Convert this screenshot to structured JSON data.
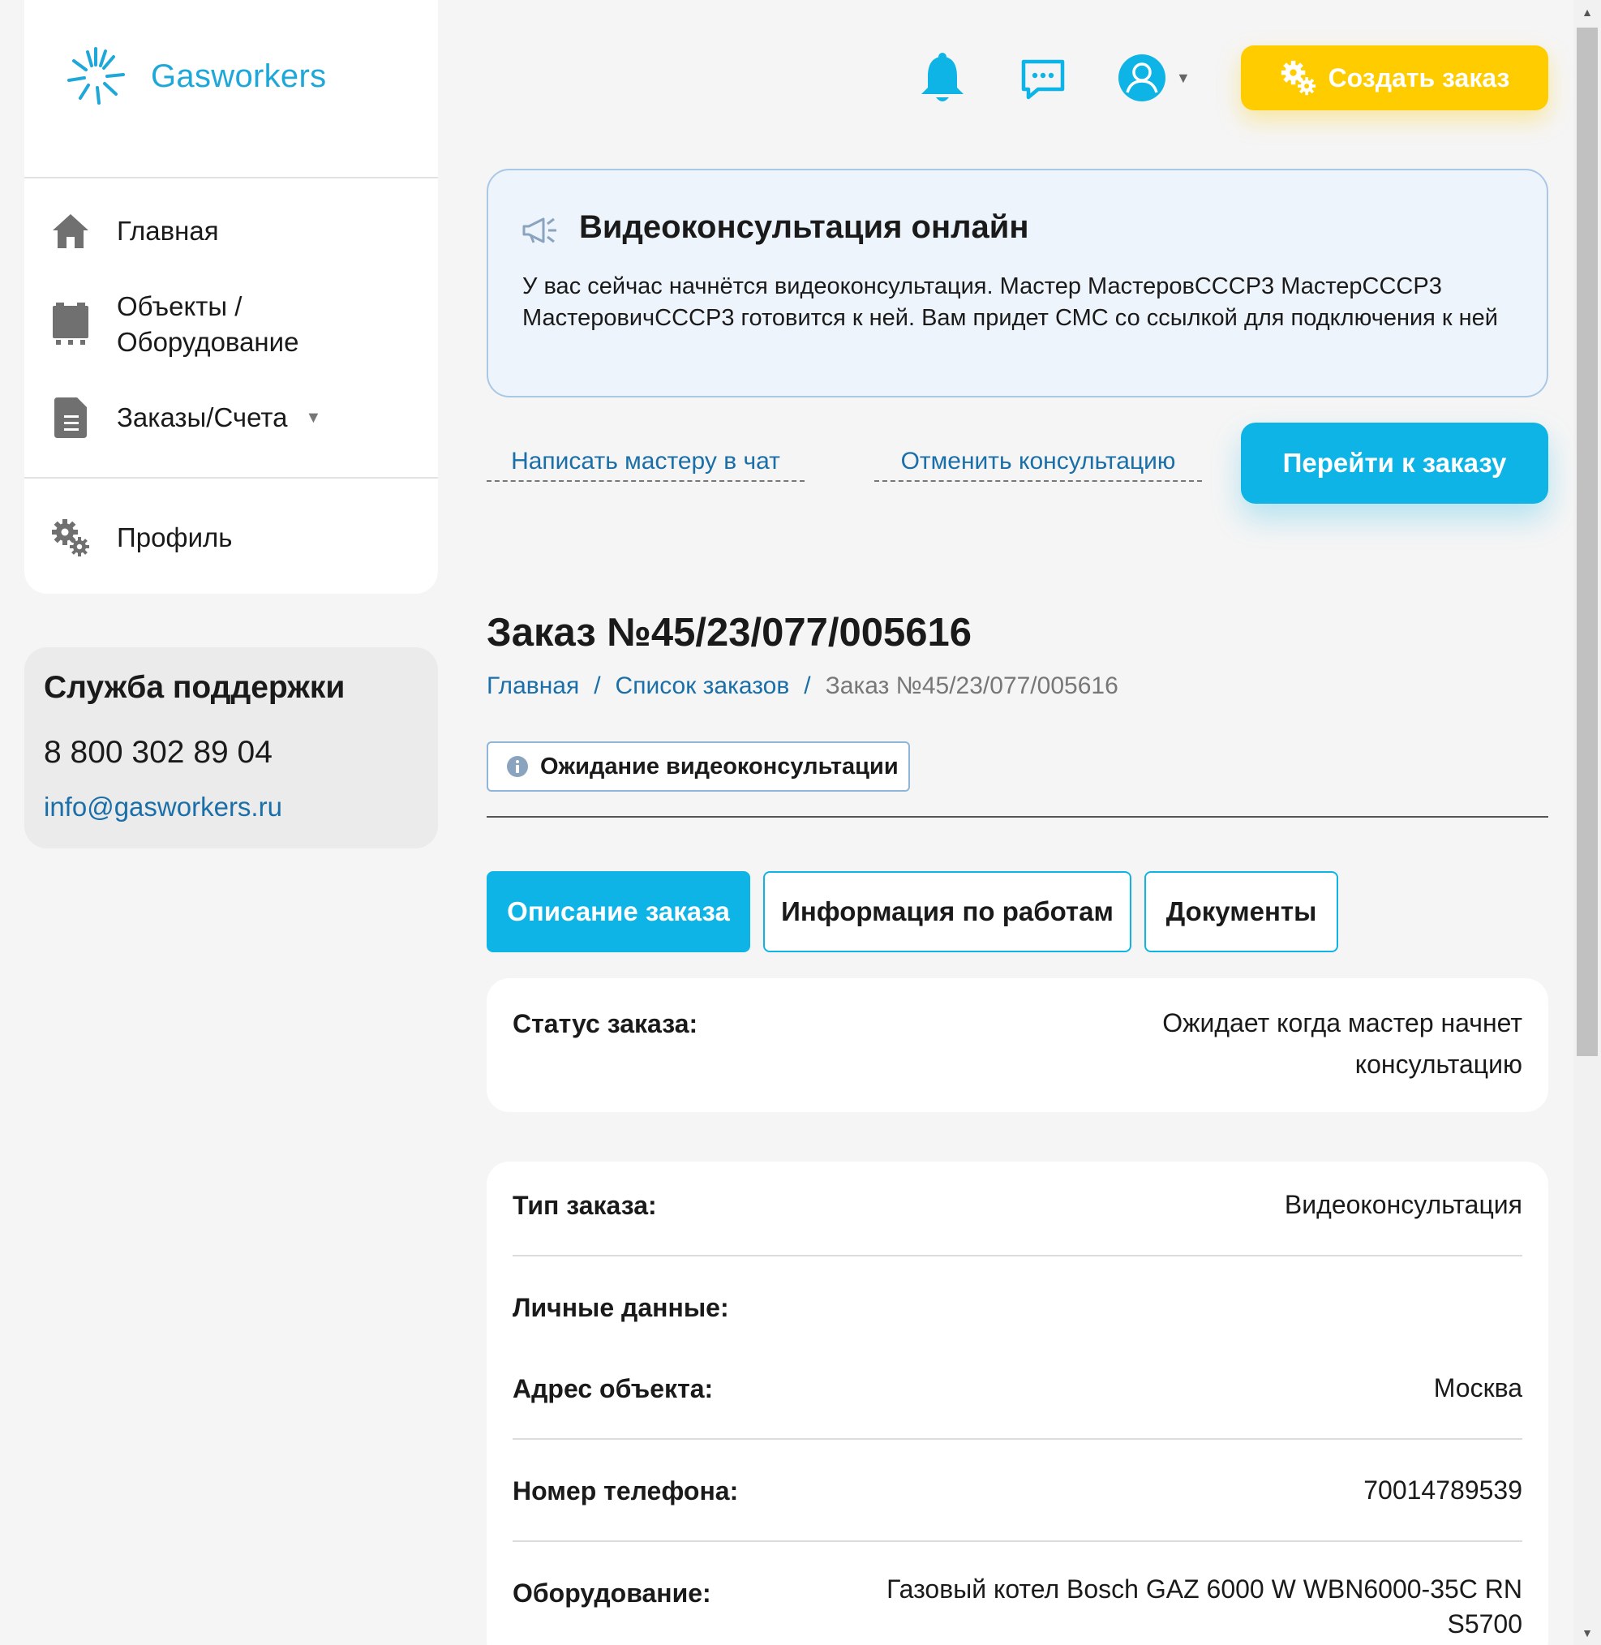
{
  "brand": {
    "name": "Gasworkers",
    "accent": "#1ea8d9"
  },
  "nav": {
    "home": "Главная",
    "objects_line1": "Объекты /",
    "objects_line2": "Оборудование",
    "orders": "Заказы/Счета",
    "profile": "Профиль"
  },
  "support": {
    "title": "Служба поддержки",
    "phone": "8 800 302 89 04",
    "email": "info@gasworkers.ru"
  },
  "header": {
    "create_order": "Создать заказ"
  },
  "notice": {
    "title": "Видеоконсультация онлайн",
    "text": "У вас сейчас начнётся видеоконсультация. Мастер МастеровСССР3 МастерСССР3 МастеровичСССР3 готовится к ней. Вам придет СМС со ссылкой для подключения к ней"
  },
  "actions": {
    "chat_link": "Написать мастеру в чат",
    "cancel_link": "Отменить консультацию",
    "goto_order": "Перейти к заказу"
  },
  "order": {
    "title": "Заказ №45/23/077/005616",
    "breadcrumb": [
      "Главная",
      "Список заказов",
      "Заказ №45/23/077/005616"
    ],
    "status_badge": "Ожидание видеоконсультации"
  },
  "tabs": [
    "Описание заказа",
    "Информация по работам",
    "Документы"
  ],
  "status_card": {
    "label": "Статус заказа:",
    "value_line1": "Ожидает когда мастер начнет",
    "value_line2": "консультацию"
  },
  "details": {
    "type_label": "Тип заказа:",
    "type_value": "Видеоконсультация",
    "personal_label": "Личные данные:",
    "address_label": "Адрес объекта:",
    "address_value": "Москва",
    "phone_label": "Номер телефона:",
    "phone_value": "70014789539",
    "equipment_label": "Оборудование:",
    "equipment_line1": "Газовый котел Bosch GAZ 6000 W WBN6000-35C RN",
    "equipment_line2": "S5700"
  }
}
